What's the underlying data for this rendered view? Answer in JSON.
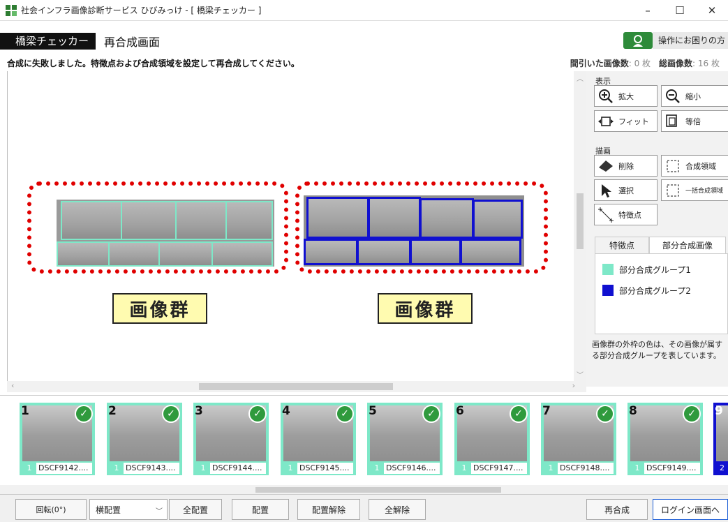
{
  "window": {
    "title": "社会インフラ画像診断サービス ひびみっけ - [ 橋梁チェッカー ]",
    "controls": [
      "–",
      "☐",
      "✕"
    ]
  },
  "header": {
    "brand": "橋梁チェッカー",
    "screen_name": "再合成画面",
    "help_text": "操作にお困りの方"
  },
  "status": {
    "message": "合成に失敗しました。特徴点および合成領域を設定して再合成してください。",
    "thinned_label": "間引いた画像数",
    "thinned_value": ": 0 枚",
    "total_label": "総画像数",
    "total_value": ": 16 枚"
  },
  "canvas": {
    "group_label_left": "画像群",
    "group_label_right": "画像群"
  },
  "panel": {
    "display_title": "表示",
    "zoom_in": "拡大",
    "zoom_out": "縮小",
    "fit": "フィット",
    "actual": "等倍",
    "draw_title": "描画",
    "delete": "削除",
    "region": "合成領域",
    "select": "選択",
    "batch_region": "一括合成領域",
    "feature": "特徴点",
    "tab_feature": "特徴点",
    "tab_partial": "部分合成画像",
    "legend": [
      {
        "label": "部分合成グループ1",
        "color": "#7ee8c8"
      },
      {
        "label": "部分合成グループ2",
        "color": "#1010d0"
      }
    ],
    "note": "画像群の外枠の色は、その画像が属する部分合成グループを表しています。"
  },
  "thumbnails": [
    {
      "num": "1",
      "group": "1",
      "name": "DSCF9142...."
    },
    {
      "num": "2",
      "group": "1",
      "name": "DSCF9143...."
    },
    {
      "num": "3",
      "group": "1",
      "name": "DSCF9144...."
    },
    {
      "num": "4",
      "group": "1",
      "name": "DSCF9145...."
    },
    {
      "num": "5",
      "group": "1",
      "name": "DSCF9146...."
    },
    {
      "num": "6",
      "group": "1",
      "name": "DSCF9147...."
    },
    {
      "num": "7",
      "group": "1",
      "name": "DSCF9148...."
    },
    {
      "num": "8",
      "group": "1",
      "name": "DSCF9149...."
    },
    {
      "num": "9",
      "group": "2",
      "name": ""
    }
  ],
  "bottom": {
    "rotate": "回転(0°)",
    "layout_select": "横配置",
    "place_all": "全配置",
    "place": "配置",
    "unplace": "配置解除",
    "remove_all": "全解除",
    "recompose": "再合成",
    "login": "ログイン画面へ"
  },
  "colors": {
    "group1": "#7ee8c8",
    "group2": "#1010d0",
    "outline": "#e00000",
    "brand_bg": "#111111",
    "help_green": "#2e8b3a"
  }
}
